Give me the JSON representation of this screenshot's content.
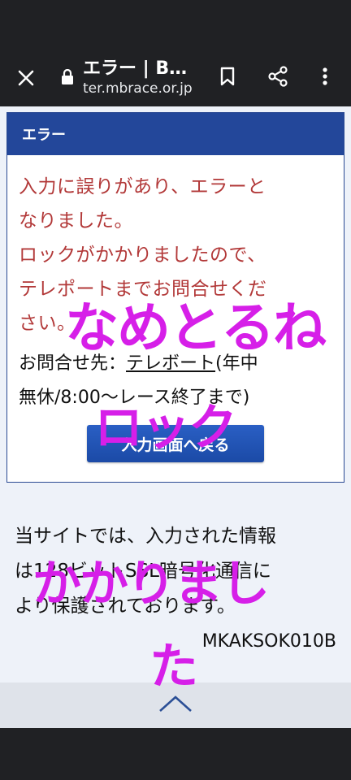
{
  "browser": {
    "tab_title": "エラー | B…",
    "url": "ter.mbrace.or.jp"
  },
  "panel": {
    "header": "エラー",
    "error_lines": [
      "入力に誤りがあり、エラーと",
      "なりました。",
      "ロックがかかりましたので、",
      "テレポートまでお問合せくだ",
      "さい。"
    ],
    "contact_prefix": "お問合せ先：",
    "contact_link": "テレボート",
    "contact_suffix_line1": "(年中",
    "contact_line2": "無休/8:00～レース終了まで)",
    "return_button": "入力画面へ戻る"
  },
  "ssl_lines": [
    "当サイトでは、入力された情報",
    "は128ビットSSL暗号化通信に",
    "より保護されております。"
  ],
  "page_code": "MKAKSOK010B",
  "overlay_text": {
    "line1": "なめとるね",
    "line2": "ロック",
    "line3": "かかりまし",
    "line4": "た"
  },
  "colors": {
    "header_blue": "#23479a",
    "error_red": "#b23838",
    "overlay_magenta": "#d61fe8"
  },
  "icons": [
    "close-icon",
    "lock-icon",
    "bookmark-icon",
    "share-icon",
    "menu-icon",
    "chevron-up-icon"
  ]
}
